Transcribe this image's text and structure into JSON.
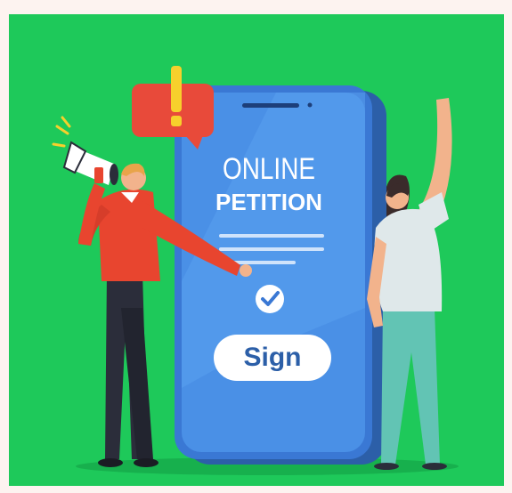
{
  "phone": {
    "title_line1": "ONLINE",
    "title_line2": "PETITION",
    "sign_label": "Sign"
  },
  "colors": {
    "background": "#1ec95a",
    "phone_screen": "#4a90e6",
    "phone_frame": "#2c5fa8",
    "alert": "#e84a3a",
    "exclamation": "#f7d02c",
    "man_sweater": "#e8452f",
    "woman_pants": "#62c4b4"
  },
  "icons": [
    "megaphone-icon",
    "exclamation-icon",
    "checkmark-icon"
  ]
}
